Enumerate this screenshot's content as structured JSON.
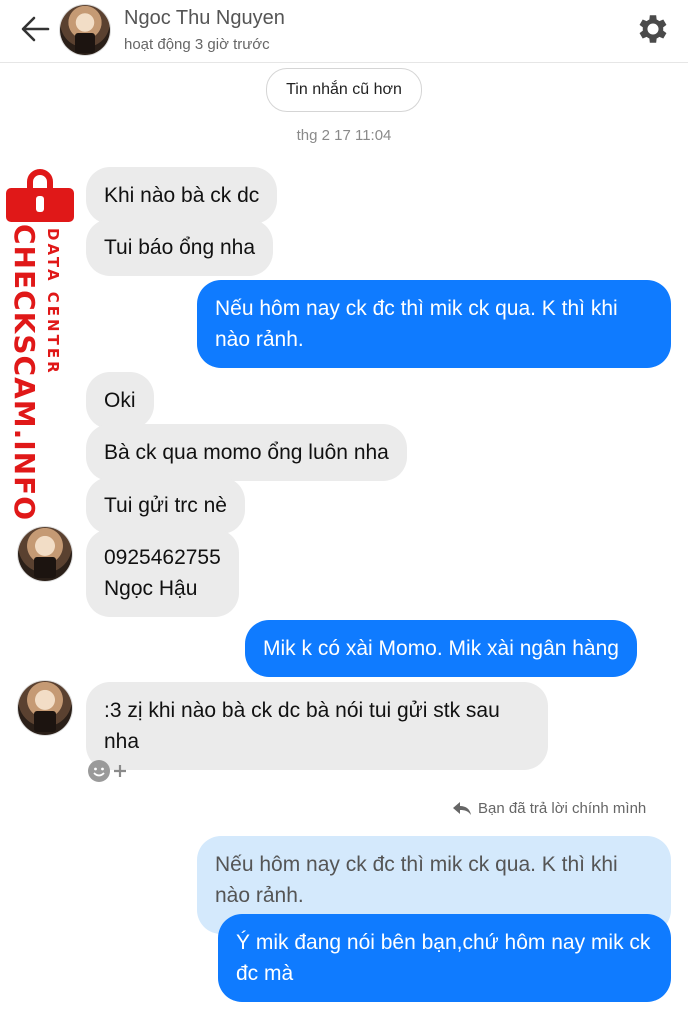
{
  "header": {
    "contact_name": "Ngoc Thu Nguyen",
    "status": "hoạt động 3 giờ trước",
    "back_icon": "arrow-left",
    "settings_icon": "gear"
  },
  "older_messages_label": "Tin nhắn cũ hơn",
  "timestamp": "thg 2 17 11:04",
  "messages": [
    {
      "from": "them",
      "text": "Khi nào bà ck dc"
    },
    {
      "from": "them",
      "text": "Tui báo ổng nha"
    },
    {
      "from": "me",
      "text": "Nếu hôm nay ck đc thì mik ck qua. K thì khi nào rảnh."
    },
    {
      "from": "them",
      "text": "Oki"
    },
    {
      "from": "them",
      "text": "Bà ck qua momo ổng luôn nha"
    },
    {
      "from": "them",
      "text": "Tui gửi trc nè"
    },
    {
      "from": "them",
      "line1": "0925462755",
      "line2": "Ngọc Hậu"
    },
    {
      "from": "me",
      "text": "Mik k có xài Momo. Mik xài ngân hàng"
    },
    {
      "from": "them",
      "text": ":3 zị khi nào bà ck dc bà nói tui gửi stk sau nha"
    },
    {
      "from": "me",
      "quoted": "Nếu hôm nay ck đc thì mik ck qua. K thì khi nào rảnh.",
      "text": "Ý mik đang nói bên bạn,chứ hôm nay mik ck đc mà"
    }
  ],
  "reaction_add_icon": "smiley-plus",
  "reply_note": "Bạn đã trả lời chính mình",
  "watermark": {
    "main": "CHECKSCAM.INFO",
    "sub": "DATA CENTER"
  },
  "colors": {
    "outgoing": "#0f7bff",
    "incoming": "#ebebeb",
    "quoted": "#d4e9fc",
    "watermark": "#e01818"
  }
}
